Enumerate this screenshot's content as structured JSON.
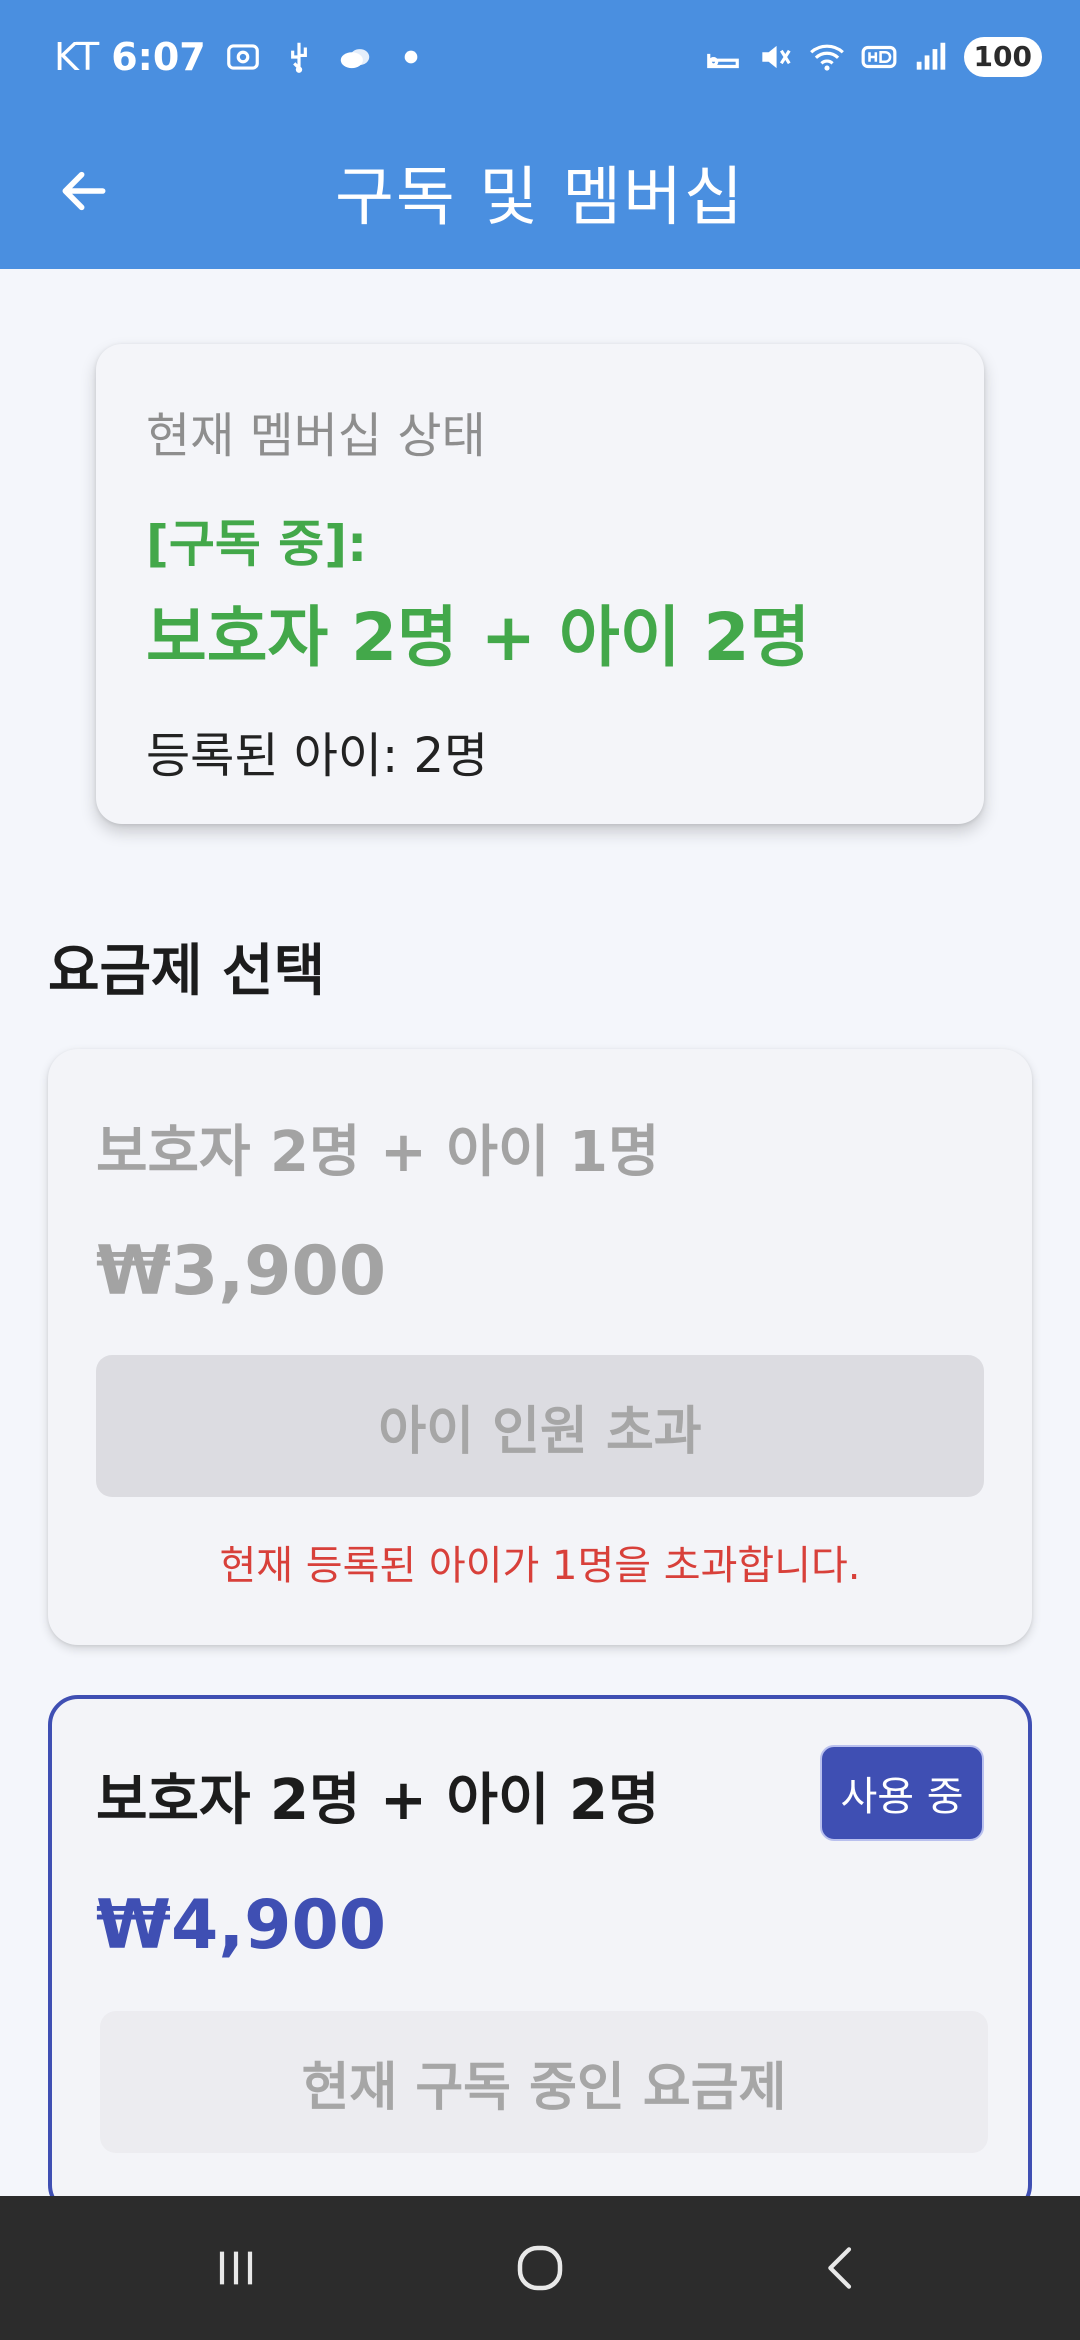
{
  "status_bar": {
    "carrier": "KT",
    "time": "6:07",
    "battery": "100"
  },
  "app_bar": {
    "title": "구독 및 멤버십",
    "back_icon": "arrow-left-icon"
  },
  "membership_status": {
    "label": "현재 멤버십 상태",
    "tag": "[구독 중]:",
    "plan": "보호자 2명 + 아이 2명",
    "registered_kids": "등록된 아이: 2명",
    "accent_color": "#43a84a"
  },
  "plans_section": {
    "title": "요금제 선택",
    "plans": [
      {
        "name": "보호자 2명 + 아이 1명",
        "price": "₩3,900",
        "button_label": "아이 인원 초과",
        "warning": "현재 등록된 아이가 1명을 초과합니다.",
        "state": "disabled"
      },
      {
        "name": "보호자 2명 + 아이 2명",
        "price": "₩4,900",
        "badge": "사용 중",
        "button_label": "현재 구독 중인 요금제",
        "state": "current",
        "accent_color": "#3f4fb3"
      }
    ]
  },
  "nav_bar": {
    "recents_icon": "recents-icon",
    "home_icon": "home-icon",
    "back_icon": "back-chevron-icon"
  },
  "colors": {
    "header": "#4a8fe0",
    "warning": "#d8403a"
  }
}
